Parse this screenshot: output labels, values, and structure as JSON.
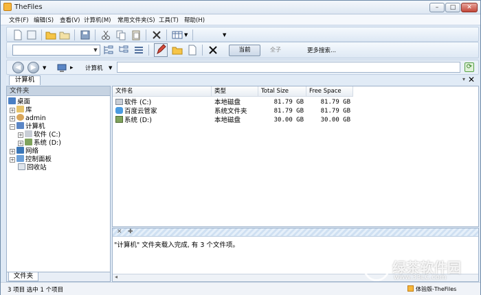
{
  "app": {
    "title": "TheFiles"
  },
  "window_buttons": {
    "minimize": "–",
    "maximize": "□",
    "close": "✕"
  },
  "menu": [
    "文件(F)",
    "编辑(S)",
    "查看(V)",
    "计算机(M)",
    "常用文件夹(S)",
    "工具(T)",
    "帮助(H)"
  ],
  "toolbar2": {
    "now_label": "当前",
    "parent_label": "全子",
    "more_search_label": "更多搜索..."
  },
  "address": {
    "crumb": "计算机",
    "value": ""
  },
  "tab": {
    "label": "计算机"
  },
  "left_panel": {
    "header": "文件夹",
    "footer_tab": "文件夹",
    "tree": [
      {
        "label": "桌面",
        "icon": "desktop-icon"
      },
      {
        "label": "库",
        "icon": "library-icon"
      },
      {
        "label": "admin",
        "icon": "user-icon"
      },
      {
        "label": "计算机",
        "icon": "computer-icon"
      },
      {
        "label": "软件 (C:)",
        "icon": "drive-icon"
      },
      {
        "label": "系统 (D:)",
        "icon": "drive-icon"
      },
      {
        "label": "网络",
        "icon": "network-icon"
      },
      {
        "label": "控制面板",
        "icon": "control-panel-icon"
      },
      {
        "label": "回收站",
        "icon": "recycle-bin-icon"
      }
    ]
  },
  "file_list": {
    "columns": [
      "文件名",
      "类型",
      "Total Size",
      "Free Space"
    ],
    "rows": [
      {
        "name": "软件 (C:)",
        "type": "本地磁盘",
        "total": "81.79 GB",
        "free": "81.79 GB",
        "icon": "drive-icon"
      },
      {
        "name": "百度云管家",
        "type": "系统文件夹",
        "total": "81.79 GB",
        "free": "81.79 GB",
        "icon": "cloud-icon"
      },
      {
        "name": "系统 (D:)",
        "type": "本地磁盘",
        "total": "30.00 GB",
        "free": "30.00 GB",
        "icon": "drive-icon"
      }
    ]
  },
  "log": {
    "message": "\"计算机\" 文件夹载入完成, 有 3 个文件项。"
  },
  "status": {
    "left": "3 项目 选中 1 个项目",
    "right": "体验版-TheFiles"
  },
  "watermark": {
    "line1": "绿茶软件园",
    "line2": "www.33LC.com"
  },
  "colors": {
    "accent": "#dfe9f5",
    "border": "#9fb3cb",
    "close": "#c2473a"
  }
}
